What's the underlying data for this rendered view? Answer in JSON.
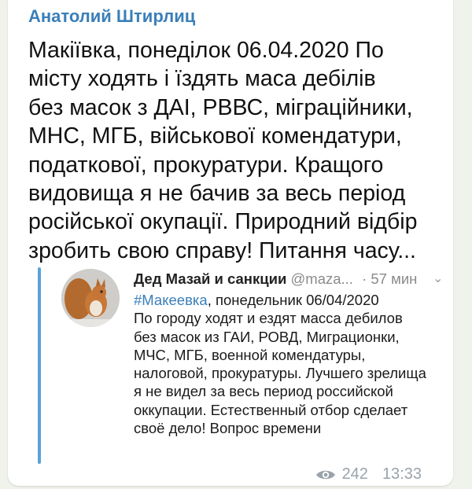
{
  "post": {
    "author": "Анатолий Штирлиц",
    "text_lines": [
      "Макіївка, понеділок 06.04.2020 По",
      "місту ходять і їздять маса дебілів",
      "без масок з ДАІ, РВВС, міграційники,",
      "МНС, МГБ, військової комендатури,",
      "податкової, прокуратури. Кращого",
      "видовища я не бачив за весь період",
      "російської окупації. Природний відбір",
      "зробить свою справу! Питання часу..."
    ],
    "views": "242",
    "time": "13:33",
    "views_icon": "eye-icon"
  },
  "quoted_tweet": {
    "author_name": "Дед Мазай и санкции",
    "handle": "@maza...",
    "time": "· 57 мин",
    "chevron_icon": "chevron-down-icon",
    "hashtag": "#Макеевка",
    "first_line_rest": ", понедельник 06/04/2020",
    "text_lines": [
      "По городу ходят и ездят масса дебилов",
      "без масок из ГАИ, РОВД, Миграционки,",
      "МЧС, МГБ, военной комендатуры,",
      "налоговой, прокуратуры. Лучшего зрелища",
      "я не видел за весь период российской",
      "оккупации. Естественный отбор сделает",
      "своё дело! Вопрос времени"
    ]
  },
  "colors": {
    "author": "#3a7fb8",
    "hashtag": "#3a7fb8",
    "quote_bar": "#5aa2d8",
    "meta": "#9aa3ab"
  }
}
